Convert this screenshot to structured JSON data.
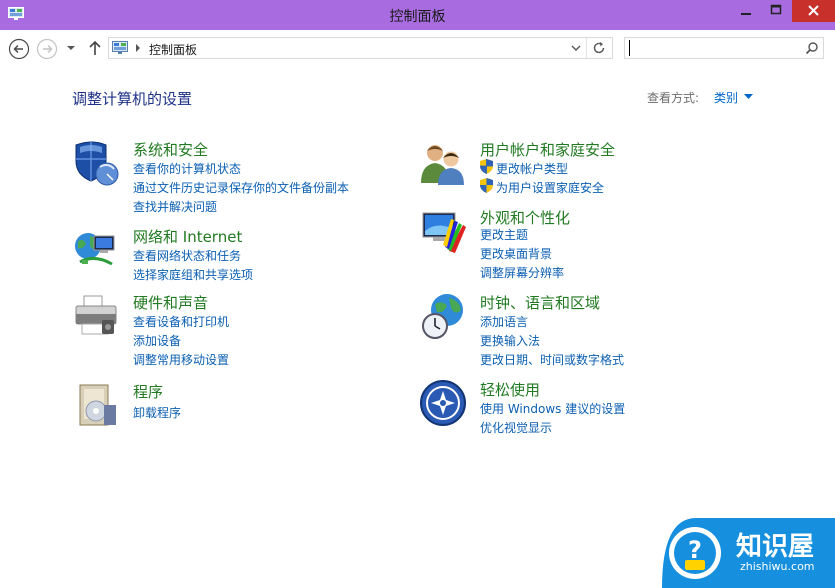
{
  "window": {
    "title": "控制面板"
  },
  "address": {
    "path": "控制面板",
    "search_placeholder": ""
  },
  "main": {
    "heading": "调整计算机的设置",
    "view_by_label": "查看方式:",
    "view_by_value": "类别"
  },
  "categories": {
    "system": {
      "title": "系统和安全",
      "links": [
        "查看你的计算机状态",
        "通过文件历史记录保存你的文件备份副本",
        "查找并解决问题"
      ]
    },
    "network": {
      "title": "网络和 Internet",
      "links": [
        "查看网络状态和任务",
        "选择家庭组和共享选项"
      ]
    },
    "hardware": {
      "title": "硬件和声音",
      "links": [
        "查看设备和打印机",
        "添加设备",
        "调整常用移动设置"
      ]
    },
    "programs": {
      "title": "程序",
      "links": [
        "卸载程序"
      ]
    },
    "users": {
      "title": "用户帐户和家庭安全",
      "links": [
        "更改帐户类型",
        "为用户设置家庭安全"
      ]
    },
    "appearance": {
      "title": "外观和个性化",
      "links": [
        "更改主题",
        "更改桌面背景",
        "调整屏幕分辨率"
      ]
    },
    "clock": {
      "title": "时钟、语言和区域",
      "links": [
        "添加语言",
        "更换输入法",
        "更改日期、时间或数字格式"
      ]
    },
    "ease": {
      "title": "轻松使用",
      "links": [
        "使用 Windows 建议的设置",
        "优化视觉显示"
      ]
    }
  },
  "watermark": {
    "brand": "知识屋",
    "url": "zhishiwu.com"
  },
  "colors": {
    "titlebar": "#a86ce0",
    "close": "#c7302b",
    "category_title": "#217a21",
    "link": "#0b5fb3",
    "heading": "#1e3287"
  }
}
